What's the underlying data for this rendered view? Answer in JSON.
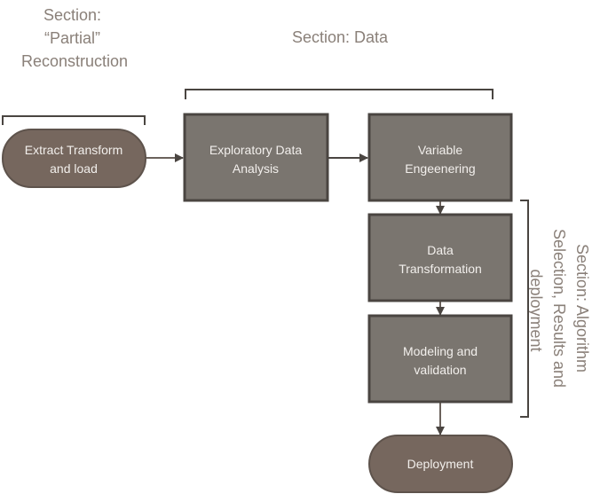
{
  "sections": {
    "partial": [
      "Section:",
      "“Partial”",
      "Reconstruction"
    ],
    "data": "Section: Data",
    "algorithm": [
      "Section: Algorithm",
      "Selection, Results and",
      "deployment"
    ]
  },
  "nodes": {
    "etl": [
      "Extract Transform",
      "and load"
    ],
    "eda": [
      "Exploratory Data",
      "Analysis"
    ],
    "ve": [
      "Variable",
      "Engeenering"
    ],
    "dt": [
      "Data",
      "Transformation"
    ],
    "mv": [
      "Modeling and",
      "validation"
    ],
    "deploy": [
      "Deployment"
    ]
  },
  "colors": {
    "terminal_fill": "#76675e",
    "process_fill": "#7a756f",
    "border": "#4a4541",
    "title_text": "#8a8079"
  }
}
